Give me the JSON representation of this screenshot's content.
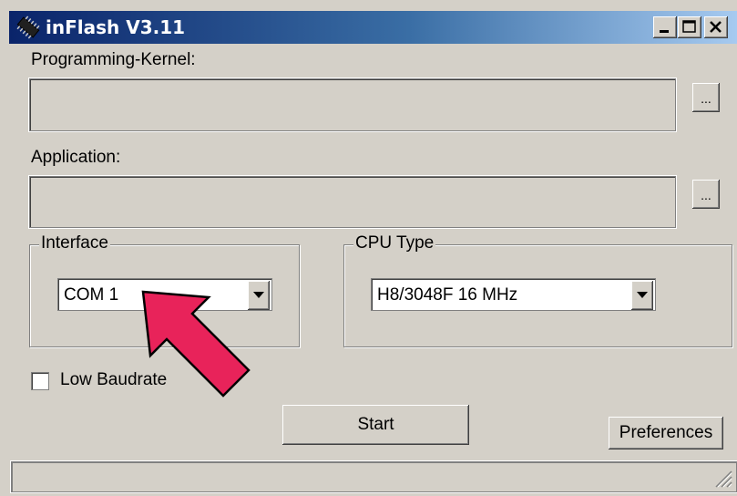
{
  "window": {
    "title": "inFlash V3.11"
  },
  "title_buttons": {
    "minimize": "minimize-icon",
    "maximize": "maximize-icon",
    "close": "close-icon"
  },
  "kernel": {
    "label": "Programming-Kernel:",
    "value": "",
    "browse_label": "..."
  },
  "application": {
    "label": "Application:",
    "value": "",
    "browse_label": "..."
  },
  "interface": {
    "title": "Interface",
    "selected": "COM 1"
  },
  "cpu": {
    "title": "CPU Type",
    "selected": "H8/3048F 16 MHz"
  },
  "low_baudrate": {
    "label": "Low Baudrate",
    "checked": false
  },
  "buttons": {
    "start": "Start",
    "preferences": "Preferences"
  },
  "status": {
    "text": ""
  },
  "colors": {
    "annotation_arrow": "#e8235a",
    "titlebar_start": "#0a246a",
    "titlebar_end": "#a6caf0"
  }
}
